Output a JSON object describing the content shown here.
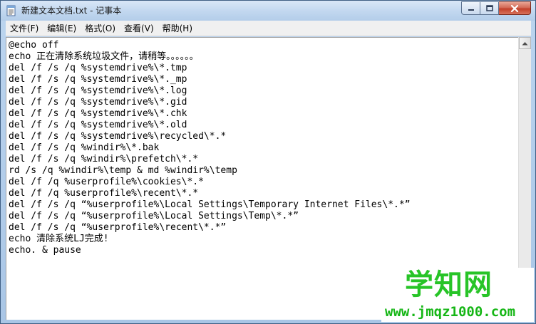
{
  "window": {
    "title": "新建文本文档.txt - 记事本",
    "icon": "notepad-icon"
  },
  "controls": {
    "minimize": "minimize-icon",
    "maximize": "maximize-icon",
    "close": "close-icon"
  },
  "menu": {
    "items": [
      {
        "label": "文件(F)"
      },
      {
        "label": "编辑(E)"
      },
      {
        "label": "格式(O)"
      },
      {
        "label": "查看(V)"
      },
      {
        "label": "帮助(H)"
      }
    ]
  },
  "editor": {
    "lines": [
      "@echo off",
      "echo 正在清除系统垃圾文件，请稍等。。。。。。",
      "del /f /s /q %systemdrive%\\*.tmp",
      "del /f /s /q %systemdrive%\\*._mp",
      "del /f /s /q %systemdrive%\\*.log",
      "del /f /s /q %systemdrive%\\*.gid",
      "del /f /s /q %systemdrive%\\*.chk",
      "del /f /s /q %systemdrive%\\*.old",
      "del /f /s /q %systemdrive%\\recycled\\*.*",
      "del /f /s /q %windir%\\*.bak",
      "del /f /s /q %windir%\\prefetch\\*.*",
      "rd /s /q %windir%\\temp & md %windir%\\temp",
      "del /f /q %userprofile%\\cookies\\*.*",
      "del /f /q %userprofile%\\recent\\*.*",
      "del /f /s /q “%userprofile%\\Local Settings\\Temporary Internet Files\\*.*”",
      "del /f /s /q “%userprofile%\\Local Settings\\Temp\\*.*”",
      "del /f /s /q “%userprofile%\\recent\\*.*”",
      "echo 清除系统LJ完成!",
      "echo. & pause"
    ]
  },
  "watermark": {
    "title": "学知网",
    "url": "www.jmqz1000.com"
  }
}
